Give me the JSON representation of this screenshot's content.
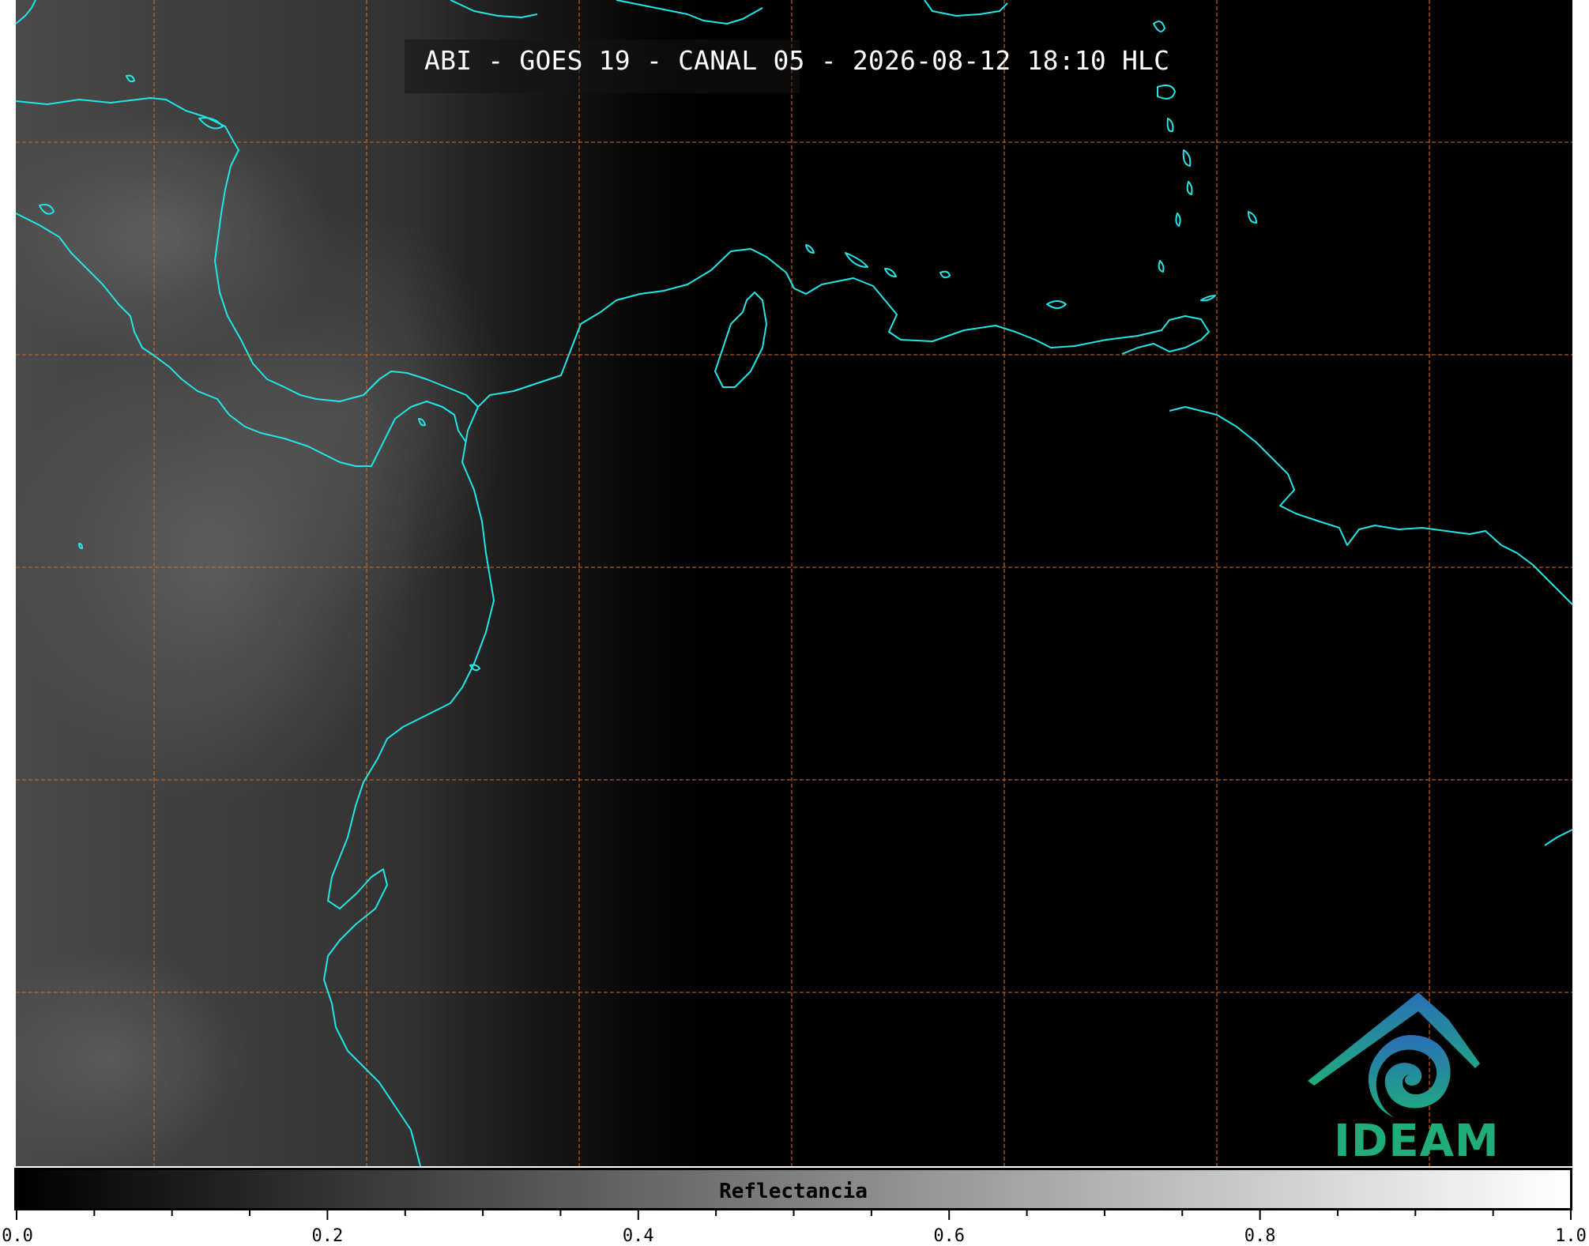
{
  "title": "ABI - GOES 19 - CANAL 05 - 2026-08-12 18:10 HLC",
  "logo": {
    "text": "IDEAM",
    "name": "ideam-logo-icon"
  },
  "colorbar": {
    "label": "Reflectancia",
    "min": 0.0,
    "max": 1.0,
    "colors": [
      "#000000",
      "#ffffff"
    ],
    "tick_labels": [
      "0.0",
      "0.2",
      "0.4",
      "0.6",
      "0.8",
      "1.0"
    ],
    "minor_step": 0.05
  },
  "colors": {
    "coastline": "#22e6e6",
    "gridline": "#c8641e",
    "background": "#000000"
  }
}
